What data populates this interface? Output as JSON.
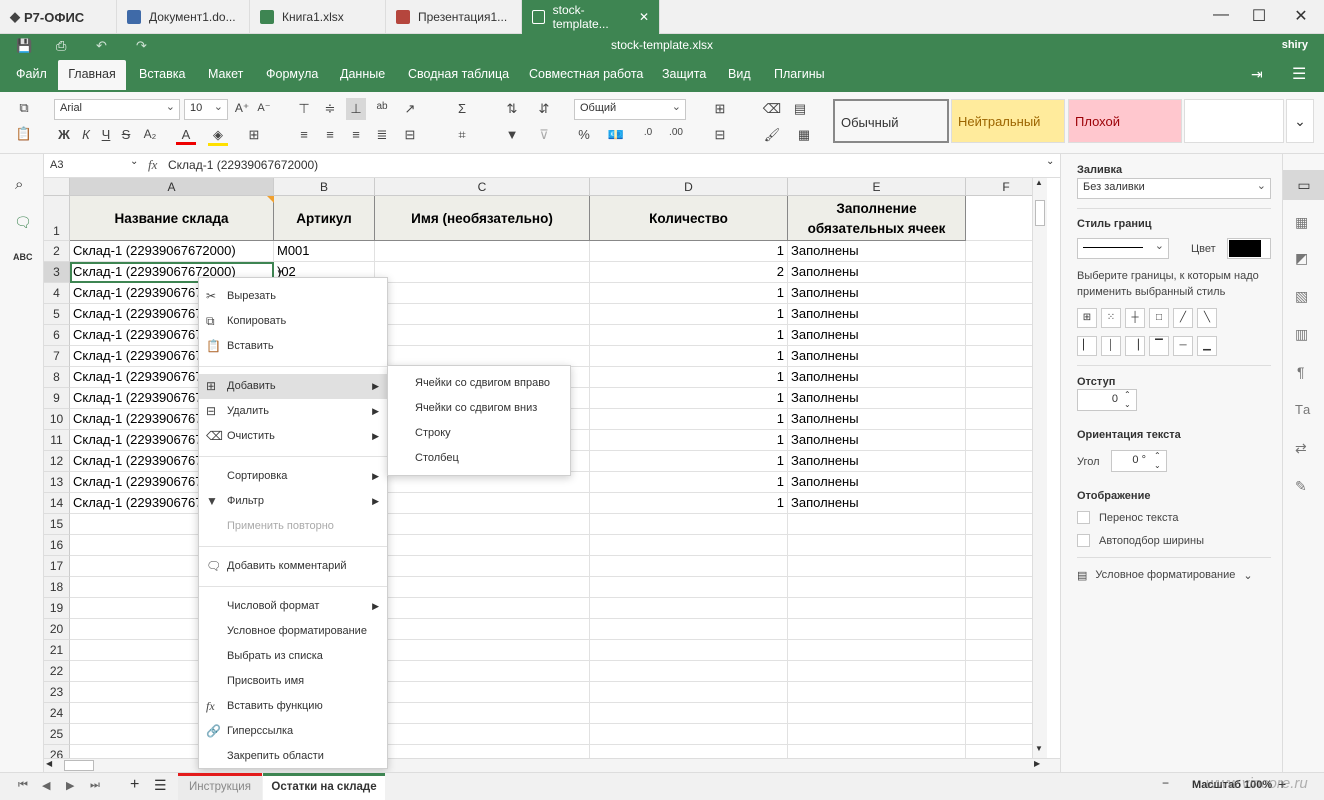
{
  "app_logo": "Р7-ОФИС",
  "tabs": [
    {
      "label": "Документ1.do...",
      "color": "#3f6aa8"
    },
    {
      "label": "Книга1.xlsx",
      "color": "#3e8552"
    },
    {
      "label": "Презентация1...",
      "color": "#b5463d"
    },
    {
      "label": "stock-template...",
      "color": "#3e8552"
    }
  ],
  "doc_title": "stock-template.xlsx",
  "user": "shiry",
  "menu": [
    "Файл",
    "Главная",
    "Вставка",
    "Макет",
    "Формула",
    "Данные",
    "Сводная таблица",
    "Совместная работа",
    "Защита",
    "Вид",
    "Плагины"
  ],
  "toolbar": {
    "font": "Arial",
    "size": "10",
    "number_format": "Общий",
    "styles": [
      {
        "label": "Обычный",
        "bg": "#ffffff",
        "color": "#000000"
      },
      {
        "label": "Нейтральный",
        "bg": "#ffeb9c",
        "color": "#9c6500"
      },
      {
        "label": "Плохой",
        "bg": "#ffc7ce",
        "color": "#9c0006"
      }
    ]
  },
  "formula": {
    "cell_ref": "A3",
    "fx": "fx",
    "value": "Склад-1 (22939067672000)"
  },
  "columns": [
    "A",
    "B",
    "C",
    "D",
    "E",
    "F"
  ],
  "header_row": {
    "A": "Название склада",
    "B": "Артикул",
    "C": "Имя (необязательно)",
    "D": "Количество",
    "E1": "Заполнение",
    "E2": "обязательных ячеек"
  },
  "rows": [
    {
      "n": "2",
      "a": "Склад-1 (22939067672000)",
      "b": "M001",
      "d": "1",
      "e": "Заполнены"
    },
    {
      "n": "3",
      "a": "Склад-1 (22939067672000)",
      "b": ")02",
      "d": "2",
      "e": "Заполнены"
    },
    {
      "n": "4",
      "a": "Склад-1 (2293906767",
      "b": "",
      "d": "1",
      "e": "Заполнены"
    },
    {
      "n": "5",
      "a": "Склад-1 (2293906767",
      "b": "",
      "d": "1",
      "e": "Заполнены"
    },
    {
      "n": "6",
      "a": "Склад-1 (2293906767",
      "b": "",
      "d": "1",
      "e": "Заполнены"
    },
    {
      "n": "7",
      "a": "Склад-1 (2293906767",
      "b": "",
      "d": "1",
      "e": "Заполнены"
    },
    {
      "n": "8",
      "a": "Склад-1 (2293906767",
      "b": "",
      "d": "1",
      "e": "Заполнены"
    },
    {
      "n": "9",
      "a": "Склад-1 (2293906767",
      "b": "",
      "d": "1",
      "e": "Заполнены"
    },
    {
      "n": "10",
      "a": "Склад-1 (2293906767",
      "b": "",
      "d": "1",
      "e": "Заполнены"
    },
    {
      "n": "11",
      "a": "Склад-1 (2293906767",
      "b": "",
      "d": "1",
      "e": "Заполнены"
    },
    {
      "n": "12",
      "a": "Склад-1 (2293906767",
      "b": "",
      "d": "1",
      "e": "Заполнены"
    },
    {
      "n": "13",
      "a": "Склад-1 (2293906767",
      "b": "",
      "d": "1",
      "e": "Заполнены"
    },
    {
      "n": "14",
      "a": "Склад-1 (2293906767",
      "b": "",
      "d": "1",
      "e": "Заполнены"
    }
  ],
  "empty_rows": [
    "15",
    "16",
    "17",
    "18",
    "19",
    "20",
    "21",
    "22",
    "23",
    "24",
    "25",
    "26"
  ],
  "context_menu": {
    "cut": "Вырезать",
    "copy": "Копировать",
    "paste": "Вставить",
    "add": "Добавить",
    "delete": "Удалить",
    "clear": "Очистить",
    "sort": "Сортировка",
    "filter": "Фильтр",
    "reapply": "Применить повторно",
    "add_comment": "Добавить комментарий",
    "number_format": "Числовой формат",
    "cond_format": "Условное форматирование",
    "pick_list": "Выбрать из списка",
    "define_name": "Присвоить имя",
    "insert_function": "Вставить функцию",
    "hyperlink": "Гиперссылка",
    "freeze": "Закрепить области"
  },
  "submenu": [
    "Ячейки со сдвигом вправо",
    "Ячейки со сдвигом вниз",
    "Строку",
    "Столбец"
  ],
  "right_panel": {
    "fill_title": "Заливка",
    "fill_value": "Без заливки",
    "border_style_title": "Стиль границ",
    "color_label": "Цвет",
    "border_hint": "Выберите границы, к которым надо применить выбранный стиль",
    "indent_title": "Отступ",
    "indent_value": "0",
    "orient_title": "Ориентация текста",
    "angle_label": "Угол",
    "angle_value": "0 °",
    "display_title": "Отображение",
    "wrap": "Перенос текста",
    "autofit": "Автоподбор ширины",
    "cond_format": "Условное форматирование"
  },
  "sheets": [
    {
      "label": "Инструкция",
      "color": "#e31b1b"
    },
    {
      "label": "Остатки на складе",
      "color": "#3e8552"
    }
  ],
  "zoom": "Масштаб 100%",
  "watermark": "www.vincore.ru"
}
